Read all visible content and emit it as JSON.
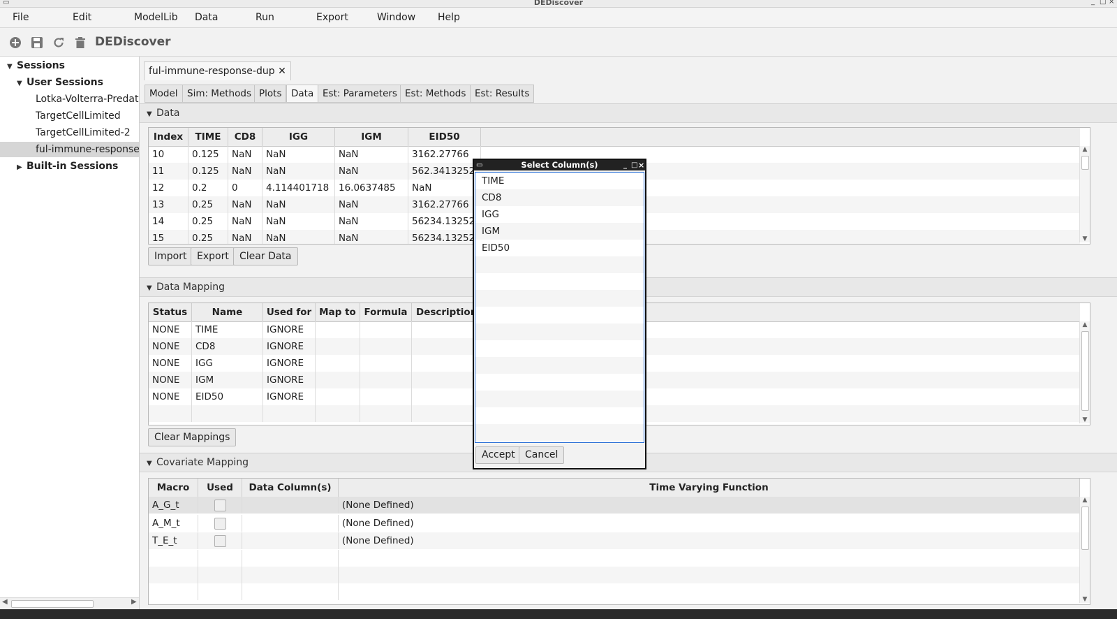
{
  "window": {
    "title": "DEDiscover"
  },
  "menu": [
    "File",
    "Edit",
    "ModelLib",
    "Data",
    "Run",
    "Export",
    "Window",
    "Help"
  ],
  "toolbar": {
    "app_name": "DEDiscover"
  },
  "tree": {
    "root": "Sessions",
    "user_sessions": "User Sessions",
    "items": [
      "Lotka-Volterra-Predator-Prey",
      "TargetCellLimited",
      "TargetCellLimited-2",
      "ful-immune-response-dup"
    ],
    "builtin": "Built-in Sessions"
  },
  "doc_tab": {
    "label": "ful-immune-response-dup",
    "close": "✕"
  },
  "subtabs": [
    "Model",
    "Sim: Methods",
    "Plots",
    "Data",
    "Est: Parameters",
    "Est: Methods",
    "Est: Results"
  ],
  "data_section": {
    "title": "Data",
    "columns": [
      "Index",
      "TIME",
      "CD8",
      "IGG",
      "IGM",
      "EID50"
    ],
    "rows": [
      [
        "10",
        "0.125",
        "NaN",
        "NaN",
        "NaN",
        "3162.27766"
      ],
      [
        "11",
        "0.125",
        "NaN",
        "NaN",
        "NaN",
        "562.3413252"
      ],
      [
        "12",
        "0.2",
        "0",
        "4.114401718",
        "16.0637485",
        "NaN"
      ],
      [
        "13",
        "0.25",
        "NaN",
        "NaN",
        "NaN",
        "3162.27766"
      ],
      [
        "14",
        "0.25",
        "NaN",
        "NaN",
        "NaN",
        "56234.13252"
      ],
      [
        "15",
        "0.25",
        "NaN",
        "NaN",
        "NaN",
        "56234.13252"
      ]
    ],
    "buttons": {
      "import": "Import",
      "export": "Export",
      "clear": "Clear Data"
    }
  },
  "mapping_section": {
    "title": "Data Mapping",
    "columns": [
      "Status",
      "Name",
      "Used for",
      "Map to",
      "Formula",
      "Description"
    ],
    "rows": [
      [
        "NONE",
        "TIME",
        "IGNORE"
      ],
      [
        "NONE",
        "CD8",
        "IGNORE"
      ],
      [
        "NONE",
        "IGG",
        "IGNORE"
      ],
      [
        "NONE",
        "IGM",
        "IGNORE"
      ],
      [
        "NONE",
        "EID50",
        "IGNORE"
      ]
    ],
    "clear_button": "Clear Mappings"
  },
  "covariate_section": {
    "title": "Covariate Mapping",
    "columns": [
      "Macro",
      "Used",
      "Data Column(s)",
      "Time Varying Function"
    ],
    "rows": [
      [
        "A_G_t",
        "(None Defined)"
      ],
      [
        "A_M_t",
        "(None Defined)"
      ],
      [
        "T_E_t",
        "(None Defined)"
      ]
    ]
  },
  "dialog": {
    "title": "Select Column(s)",
    "items": [
      "TIME",
      "CD8",
      "IGG",
      "IGM",
      "EID50"
    ],
    "accept": "Accept",
    "cancel": "Cancel"
  }
}
